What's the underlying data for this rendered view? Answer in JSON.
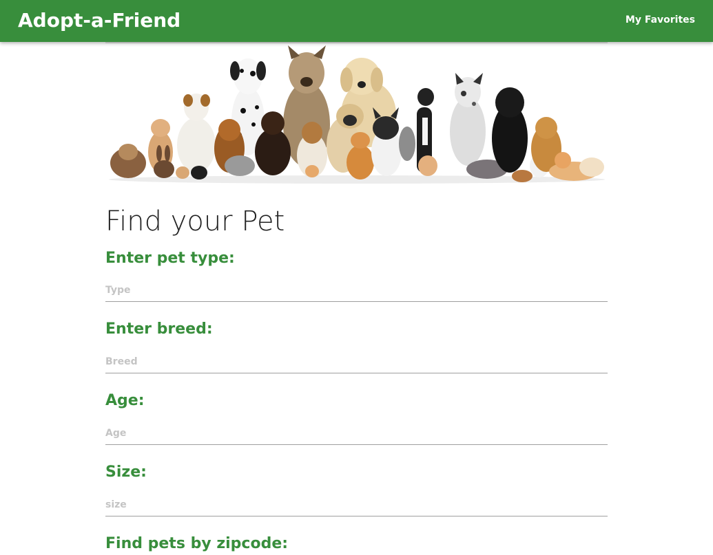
{
  "navbar": {
    "brand": "Adopt-a-Friend",
    "favorites_link": "My Favorites",
    "color": "#388e3c"
  },
  "hero": {
    "icon": "pets-group-photo"
  },
  "main": {
    "title": "Find your Pet",
    "fields": [
      {
        "label": "Enter pet type:",
        "placeholder": "Type",
        "value": ""
      },
      {
        "label": "Enter breed:",
        "placeholder": "Breed",
        "value": ""
      },
      {
        "label": "Age:",
        "placeholder": "Age",
        "value": ""
      },
      {
        "label": "Size:",
        "placeholder": "size",
        "value": ""
      },
      {
        "label": "Find pets by zipcode:"
      }
    ]
  }
}
